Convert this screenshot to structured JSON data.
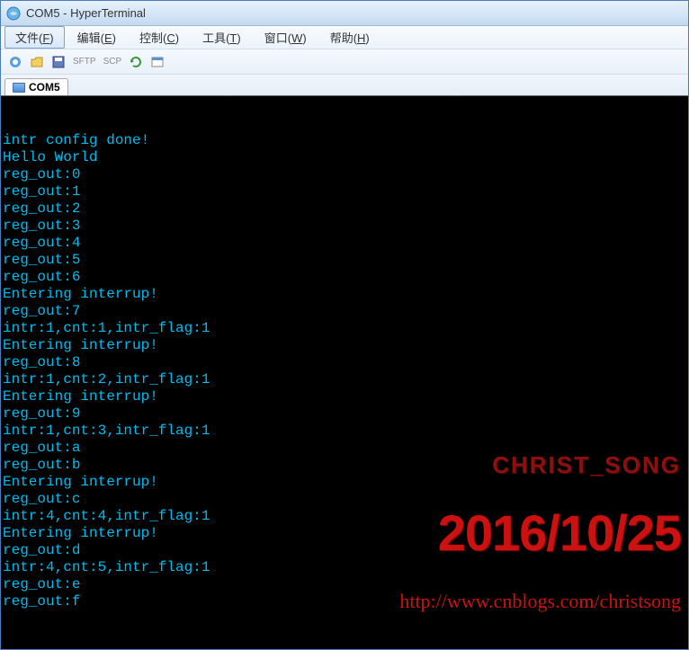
{
  "window": {
    "title": "COM5 - HyperTerminal"
  },
  "menubar": {
    "items": [
      {
        "label": "文件(F)",
        "key": "F"
      },
      {
        "label": "编辑(E)",
        "key": "E"
      },
      {
        "label": "控制(C)",
        "key": "C"
      },
      {
        "label": "工具(T)",
        "key": "T"
      },
      {
        "label": "窗口(W)",
        "key": "W"
      },
      {
        "label": "帮助(H)",
        "key": "H"
      }
    ]
  },
  "toolbar": {
    "sftp": "SFTP",
    "scp": "SCP"
  },
  "tab": {
    "label": "COM5"
  },
  "terminal": {
    "lines": [
      "intr config done!",
      "Hello World",
      "reg_out:0",
      "reg_out:1",
      "reg_out:2",
      "reg_out:3",
      "reg_out:4",
      "reg_out:5",
      "reg_out:6",
      "Entering interrup!",
      "reg_out:7",
      "intr:1,cnt:1,intr_flag:1",
      "Entering interrup!",
      "reg_out:8",
      "intr:1,cnt:2,intr_flag:1",
      "Entering interrup!",
      "reg_out:9",
      "intr:1,cnt:3,intr_flag:1",
      "reg_out:a",
      "reg_out:b",
      "Entering interrup!",
      "reg_out:c",
      "intr:4,cnt:4,intr_flag:1",
      "Entering interrup!",
      "reg_out:d",
      "intr:4,cnt:5,intr_flag:1",
      "reg_out:e",
      "reg_out:f"
    ]
  },
  "watermark": {
    "name": "CHRIST_SONG",
    "date": "2016/10/25",
    "url": "http://www.cnblogs.com/christsong"
  }
}
